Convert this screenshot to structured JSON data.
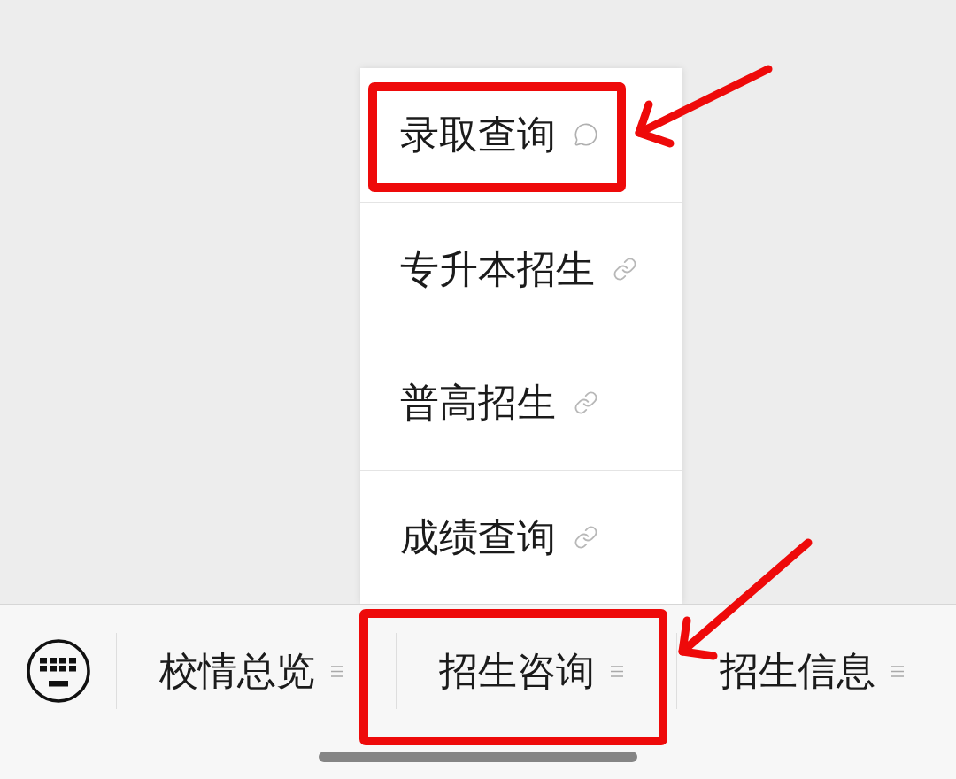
{
  "popup_menu": {
    "items": [
      {
        "label": "录取查询",
        "kind": "chat",
        "annotated": true
      },
      {
        "label": "专升本招生",
        "kind": "link",
        "annotated": false
      },
      {
        "label": "普高招生",
        "kind": "link",
        "annotated": false
      },
      {
        "label": "成绩查询",
        "kind": "link",
        "annotated": false
      }
    ]
  },
  "bottom_menu": {
    "items": [
      {
        "label": "校情总览",
        "annotated": false
      },
      {
        "label": "招生咨询",
        "annotated": true
      },
      {
        "label": "招生信息",
        "annotated": false
      }
    ]
  }
}
